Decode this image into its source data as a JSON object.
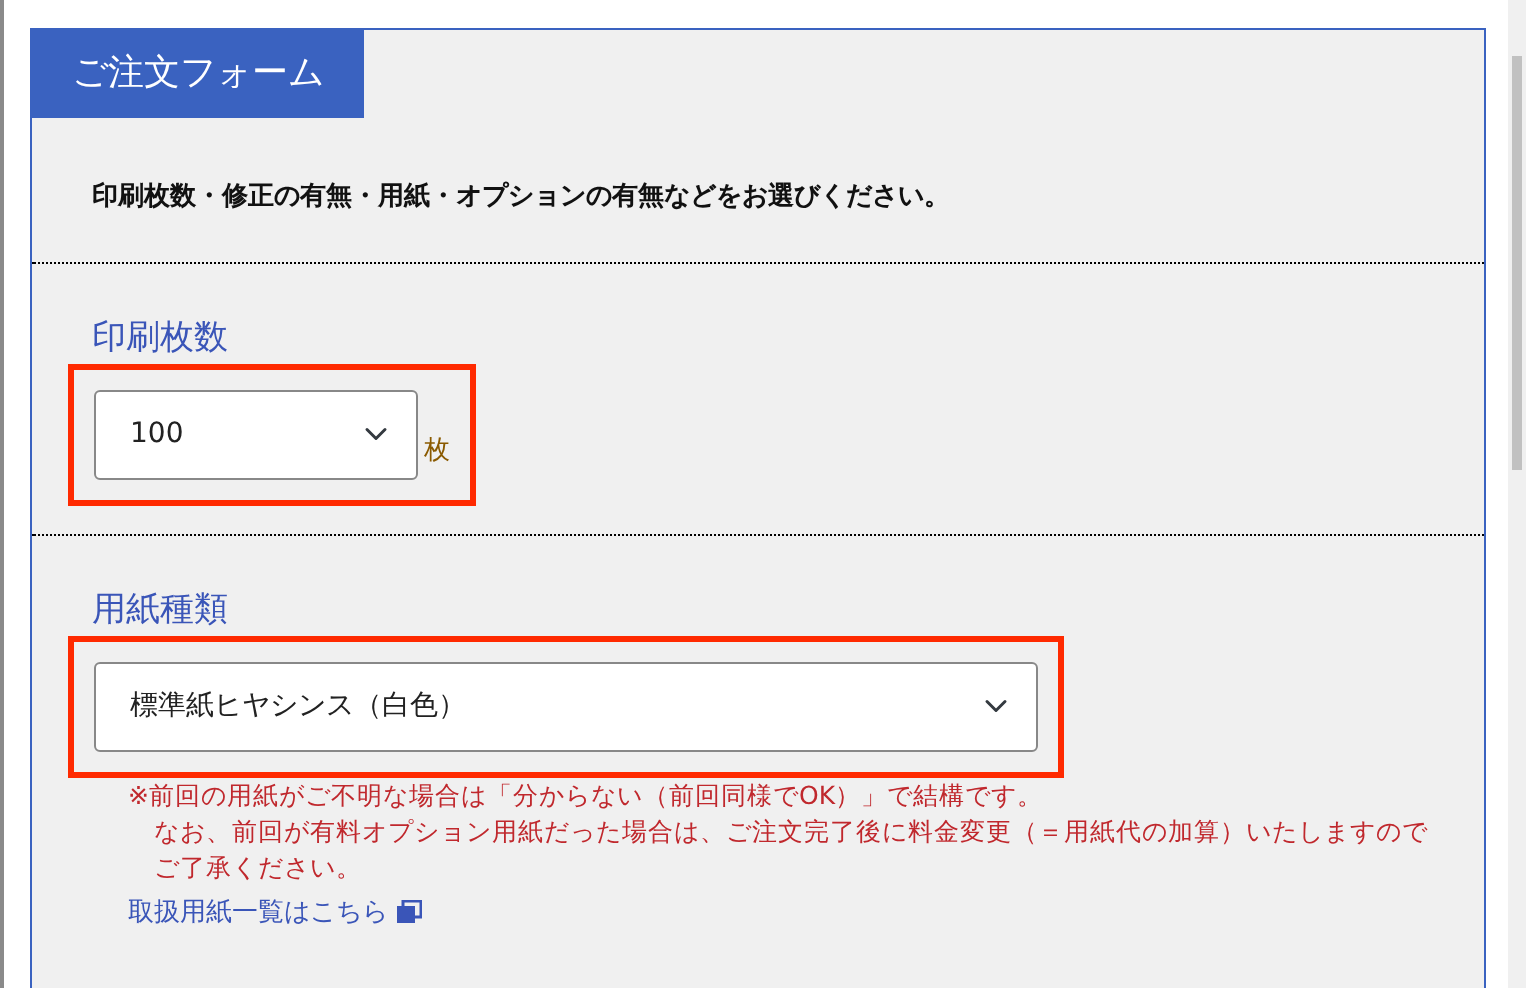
{
  "form": {
    "title": "ご注文フォーム",
    "intro": "印刷枚数・修正の有無・用紙・オプションの有無などをお選びください。",
    "sections": [
      {
        "kind": "quantity",
        "label": "印刷枚数",
        "value": "100",
        "unit": "枚",
        "highlighted": true
      },
      {
        "kind": "paper",
        "label": "用紙種類",
        "value": "標準紙ヒヤシンス（白色）",
        "highlighted": true,
        "notes": [
          "※前回の用紙がご不明な場合は「分からない（前回同様でOK）」で結構です。",
          "なお、前回が有料オプション用紙だった場合は、ご注文完了後に料金変更（＝用紙代の加算）いたしますのでご了承ください。"
        ],
        "link": "取扱用紙一覧はこちら"
      }
    ]
  }
}
